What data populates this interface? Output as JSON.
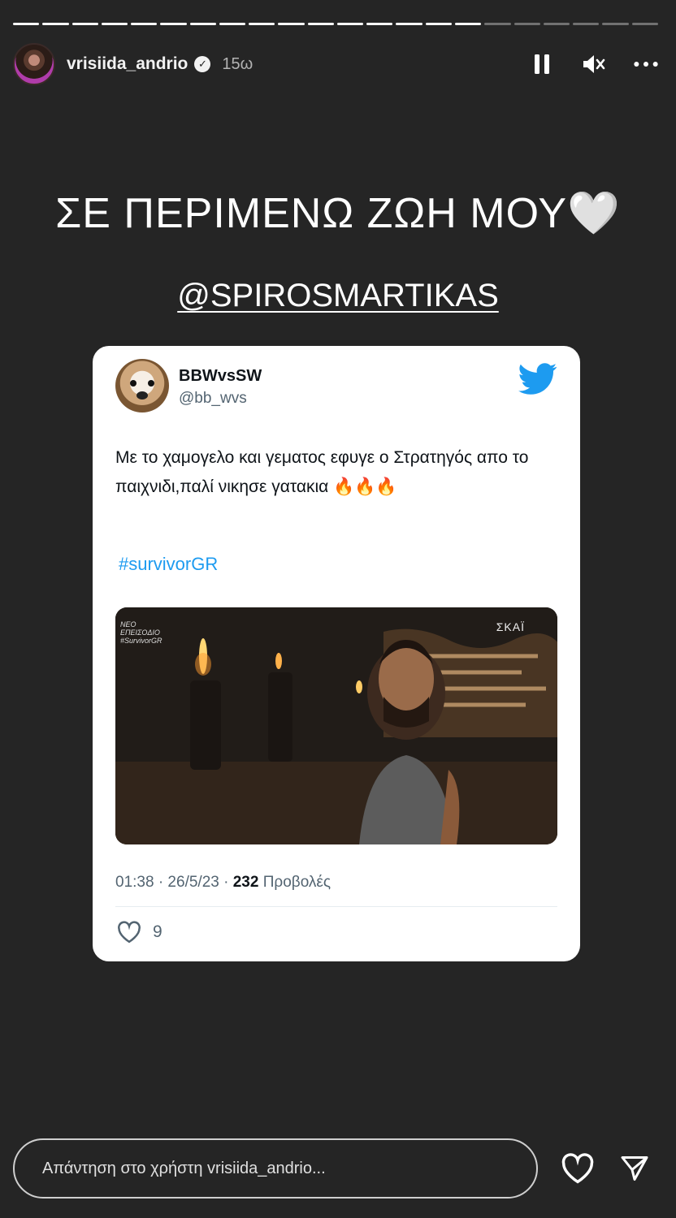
{
  "story": {
    "segments_total": 22,
    "segments_viewed": 16,
    "username": "vrisiida_andrio",
    "verified": true,
    "time_ago": "15ω"
  },
  "content": {
    "headline": "ΣΕ ΠΕΡΙΜΕΝΩ ΖΩΗ ΜΟΥ🤍",
    "mention": "@SPIROSMARTIKAS"
  },
  "tweet": {
    "name": "BBWvsSW",
    "handle": "@bb_wvs",
    "text": "Με το χαμογελο  και γεματος εφυγε ο Στρατηγός απο το παιχνιδι,παλί νικησε γατακια 🔥🔥🔥",
    "hashtag": "#survivorGR",
    "media_overlay_left": "ΝΕΟ ΕΠΕΙΣΟΔΙΟ #SurvivorGR",
    "media_overlay_right": "ΣΚΑΪ",
    "time": "01:38 · 26/5/23 · ",
    "views_count": "232",
    "views_label": " Προβολές",
    "likes": "9",
    "brand_color": "#1d9bf0"
  },
  "reply": {
    "placeholder": "Απάντηση στο χρήστη vrisiida_andrio..."
  },
  "icons": {
    "pause": "pause-icon",
    "mute": "mute-icon",
    "more": "more-icon",
    "like": "heart-icon",
    "share": "send-icon"
  }
}
